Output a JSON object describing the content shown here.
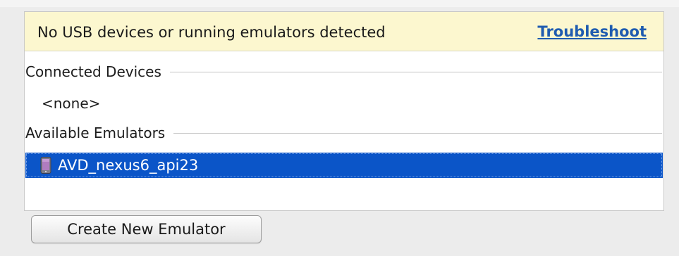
{
  "banner": {
    "message": "No USB devices or running emulators detected",
    "link_label": "Troubleshoot",
    "background_color": "#fcf7cf",
    "link_color": "#1f5cb0"
  },
  "sections": {
    "connected": {
      "label": "Connected Devices",
      "empty_text": "<none>"
    },
    "emulators": {
      "label": "Available Emulators",
      "items": [
        {
          "name": "AVD_nexus6_api23",
          "icon": "phone-icon",
          "selected": true
        }
      ]
    }
  },
  "actions": {
    "create_label": "Create New Emulator"
  },
  "colors": {
    "selection": "#0b55c8",
    "panel_background": "#ffffff",
    "window_background": "#ececec"
  }
}
